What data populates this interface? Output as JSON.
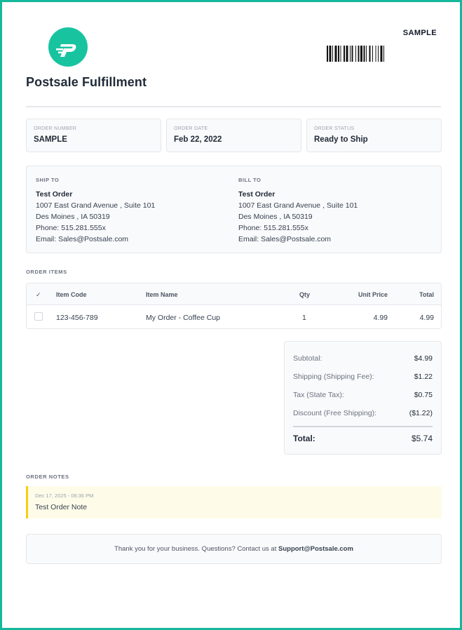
{
  "header": {
    "company_name": "Postsale Fulfillment",
    "sample_label": "SAMPLE",
    "logo_icon": "postsale-logo-icon",
    "accent_color": "#18c4a0",
    "border_color": "#14b89a"
  },
  "order_info": [
    {
      "label": "ORDER NUMBER",
      "value": "SAMPLE"
    },
    {
      "label": "ORDER DATE",
      "value": "Feb 22, 2022"
    },
    {
      "label": "ORDER STATUS",
      "value": "Ready to Ship"
    }
  ],
  "ship_to": {
    "heading": "SHIP TO",
    "name": "Test Order",
    "line1": "1007 East Grand Avenue , Suite 101",
    "line2": "Des Moines , IA 50319",
    "phone": "Phone: 515.281.555x",
    "email": "Email: Sales@Postsale.com"
  },
  "bill_to": {
    "heading": "BILL TO",
    "name": "Test Order",
    "line1": "1007 East Grand Avenue , Suite 101",
    "line2": "Des Moines , IA 50319",
    "phone": "Phone: 515.281.555x",
    "email": "Email: Sales@Postsale.com"
  },
  "items": {
    "title": "ORDER ITEMS",
    "headers": {
      "check": "✓",
      "code": "Item Code",
      "name": "Item Name",
      "qty": "Qty",
      "unit_price": "Unit Price",
      "total": "Total"
    },
    "rows": [
      {
        "code": "123-456-789",
        "name": "My Order - Coffee Cup",
        "qty": "1",
        "unit_price": "4.99",
        "total": "4.99"
      }
    ]
  },
  "totals": {
    "subtotal_label": "Subtotal:",
    "subtotal": "$4.99",
    "shipping_label": "Shipping (Shipping Fee):",
    "shipping": "$1.22",
    "tax_label": "Tax (State Tax):",
    "tax": "$0.75",
    "discount_label": "Discount (Free Shipping):",
    "discount": "($1.22)",
    "total_label": "Total:",
    "total": "$5.74"
  },
  "notes": {
    "title": "ORDER NOTES",
    "date": "Dec 17, 2025 - 06:36 PM",
    "text": "Test Order Note"
  },
  "footer": {
    "text": "Thank you for your business. Questions? Contact us at ",
    "email": "Support@Postsale.com"
  }
}
